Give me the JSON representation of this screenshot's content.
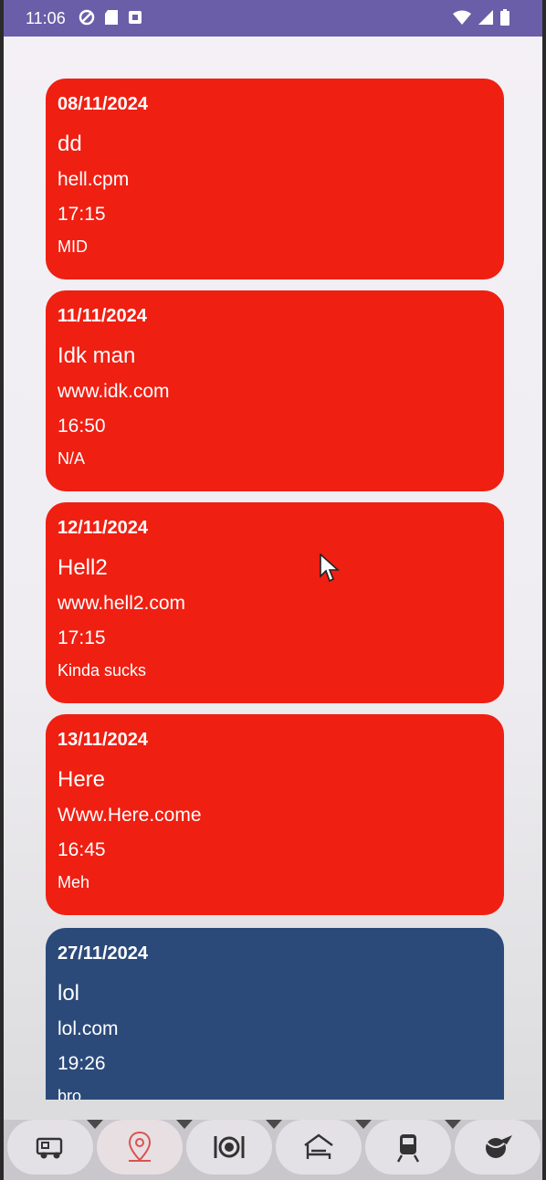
{
  "status_bar": {
    "time": "11:06"
  },
  "events": [
    {
      "date": "08/11/2024",
      "title": "dd",
      "url": "hell.cpm",
      "time": "17:15",
      "note": "MID",
      "color": "#ef1f12"
    },
    {
      "date": "11/11/2024",
      "title": "Idk man",
      "url": "www.idk.com",
      "time": "16:50",
      "note": "N/A",
      "color": "#ef1f12"
    },
    {
      "date": "12/11/2024",
      "title": "Hell2",
      "url": "www.hell2.com",
      "time": "17:15",
      "note": "Kinda sucks",
      "color": "#ef1f12"
    },
    {
      "date": "13/11/2024",
      "title": "Here",
      "url": "Www.Here.come",
      "time": "16:45",
      "note": "Meh",
      "color": "#ef1f12"
    },
    {
      "date": "27/11/2024",
      "title": "lol",
      "url": "lol.com",
      "time": "19:26",
      "note": "bro",
      "color": "#2b4a7a"
    }
  ],
  "bottom_nav": [
    {
      "icon": "camper-van-icon",
      "active": false
    },
    {
      "icon": "map-pin-icon",
      "active": true
    },
    {
      "icon": "restaurant-icon",
      "active": false
    },
    {
      "icon": "hotel-bed-icon",
      "active": false
    },
    {
      "icon": "train-icon",
      "active": false
    },
    {
      "icon": "globe-plane-icon",
      "active": false
    }
  ]
}
